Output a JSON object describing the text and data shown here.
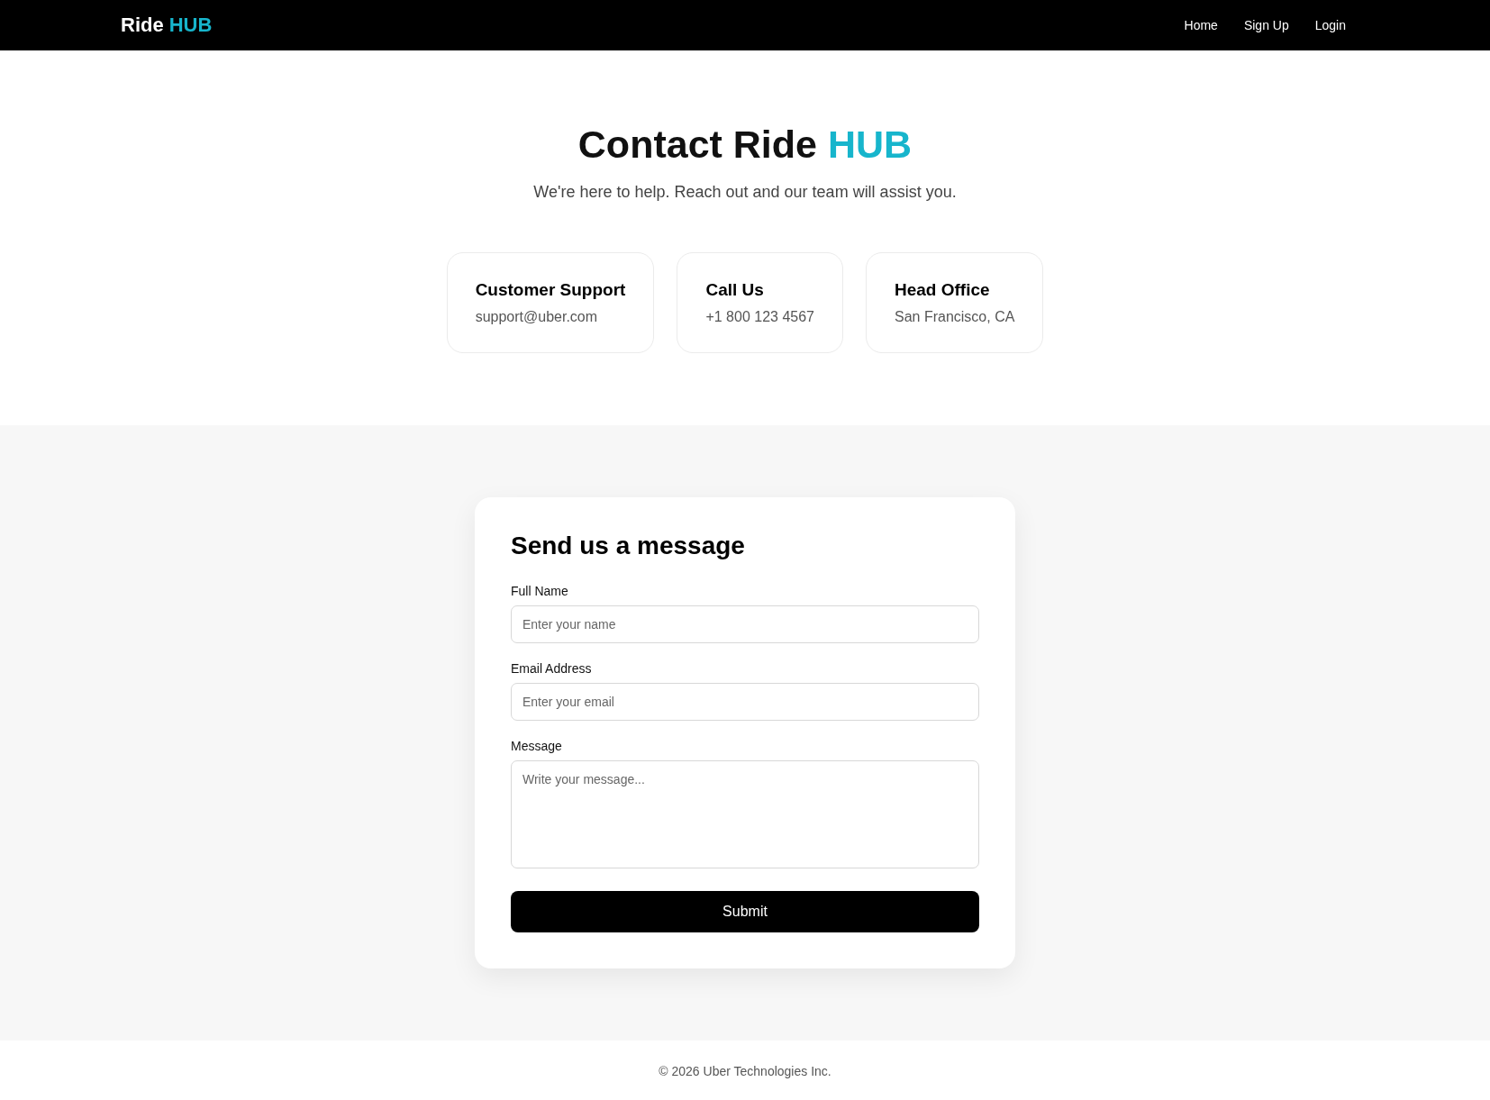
{
  "navbar": {
    "brand": {
      "text": "Ride",
      "accent": "HUB"
    },
    "links": [
      "Home",
      "Sign Up",
      "Login"
    ]
  },
  "hero": {
    "title": {
      "text": "Contact Ride",
      "accent": "HUB"
    },
    "subtitle": "We're here to help. Reach out and our team will assist you."
  },
  "contact_cards": [
    {
      "title": "Customer Support",
      "detail": "support@uber.com"
    },
    {
      "title": "Call Us",
      "detail": "+1 800 123 4567"
    },
    {
      "title": "Head Office",
      "detail": "San Francisco, CA"
    }
  ],
  "form": {
    "title": "Send us a message",
    "fields": [
      {
        "kind": "input",
        "label": "Full Name",
        "placeholder": "Enter your name"
      },
      {
        "kind": "input",
        "label": "Email Address",
        "placeholder": "Enter your email"
      },
      {
        "kind": "textarea",
        "label": "Message",
        "placeholder": "Write your message..."
      }
    ],
    "submit": "Submit"
  },
  "footer": {
    "copyright": "© 2026 Uber Technologies Inc."
  }
}
